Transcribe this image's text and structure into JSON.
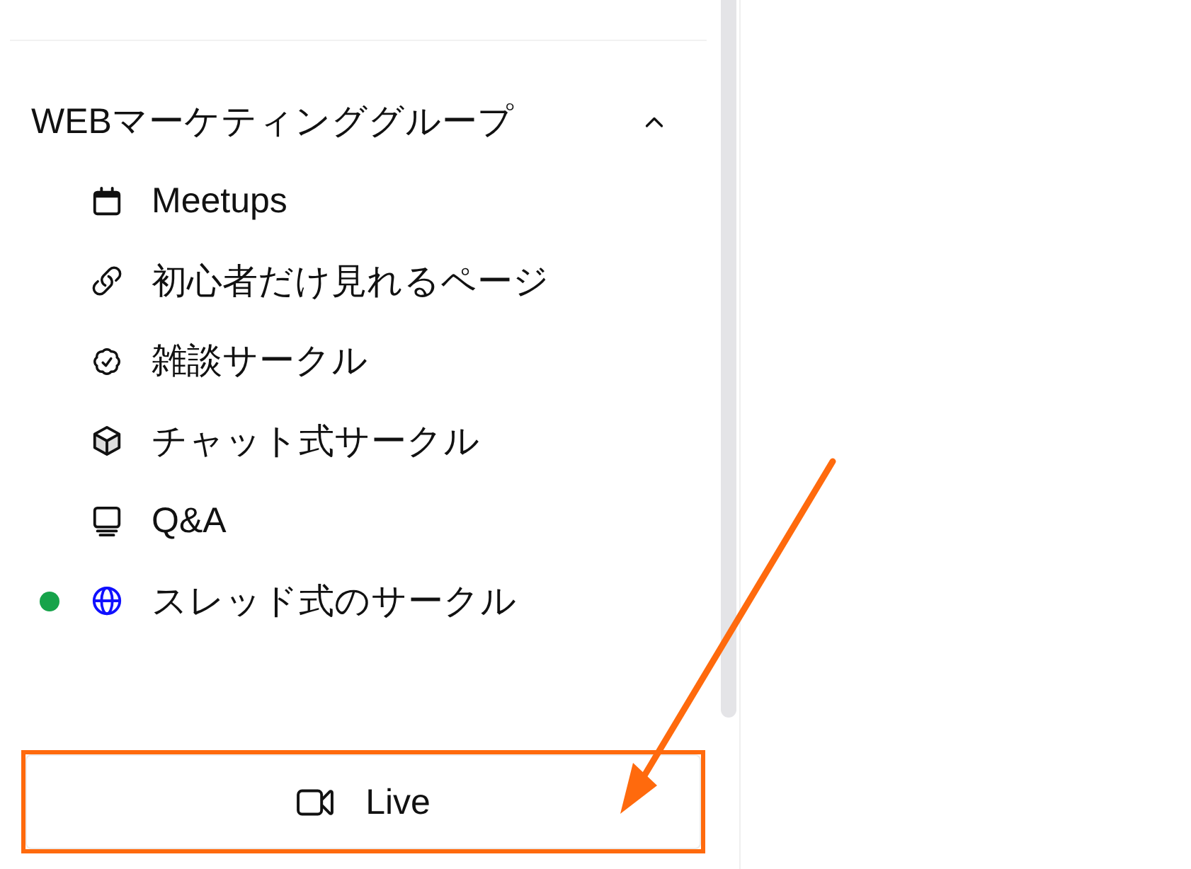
{
  "sidebar": {
    "group": {
      "title": "WEBマーケティンググループ",
      "expanded": true,
      "items": [
        {
          "label": "Meetups",
          "unread": false
        },
        {
          "label": "初心者だけ見れるページ",
          "unread": false
        },
        {
          "label": "雑談サークル",
          "unread": false
        },
        {
          "label": "チャット式サークル",
          "unread": false
        },
        {
          "label": "Q&A",
          "unread": false
        },
        {
          "label": "スレッド式のサークル",
          "unread": true
        }
      ]
    }
  },
  "live_button": {
    "label": "Live",
    "annotated": true
  }
}
